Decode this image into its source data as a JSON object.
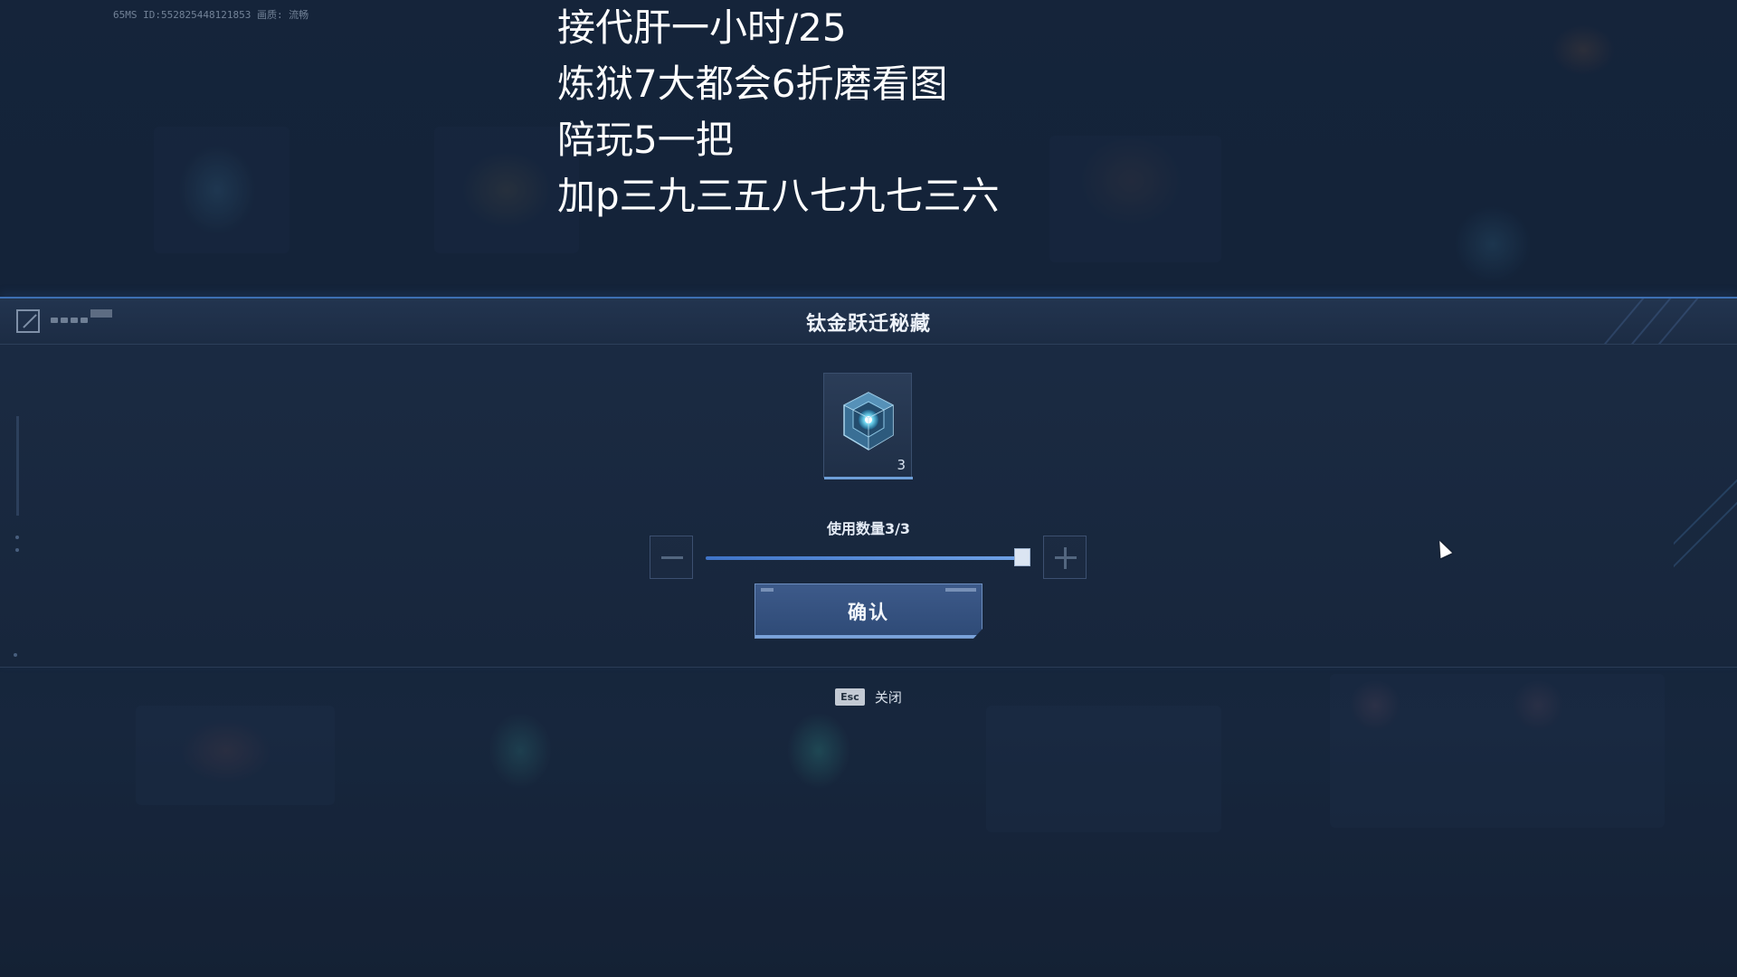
{
  "status_bar": {
    "text": "65MS  ID:552825448121853  画质: 流畅"
  },
  "promo_text": [
    "接代肝一小时/25",
    "炼狱7大都会6折磨看图",
    "陪玩5一把",
    "加p三九三五八七九七三六"
  ],
  "dialog": {
    "title": "钛金跃迁秘藏",
    "item": {
      "icon": "crystal-cube-icon",
      "count": "3"
    },
    "quantity_label": "使用数量3/3",
    "slider": {
      "value": 3,
      "max": 3
    },
    "minus_icon": "minus-icon",
    "plus_icon": "plus-icon",
    "confirm_label": "确认"
  },
  "footer": {
    "esc_key": "Esc",
    "close_label": "关闭"
  },
  "colors": {
    "accent": "#3d6fb3",
    "slider_fill": "#5a8fd8",
    "button_bg": "#35537f"
  }
}
